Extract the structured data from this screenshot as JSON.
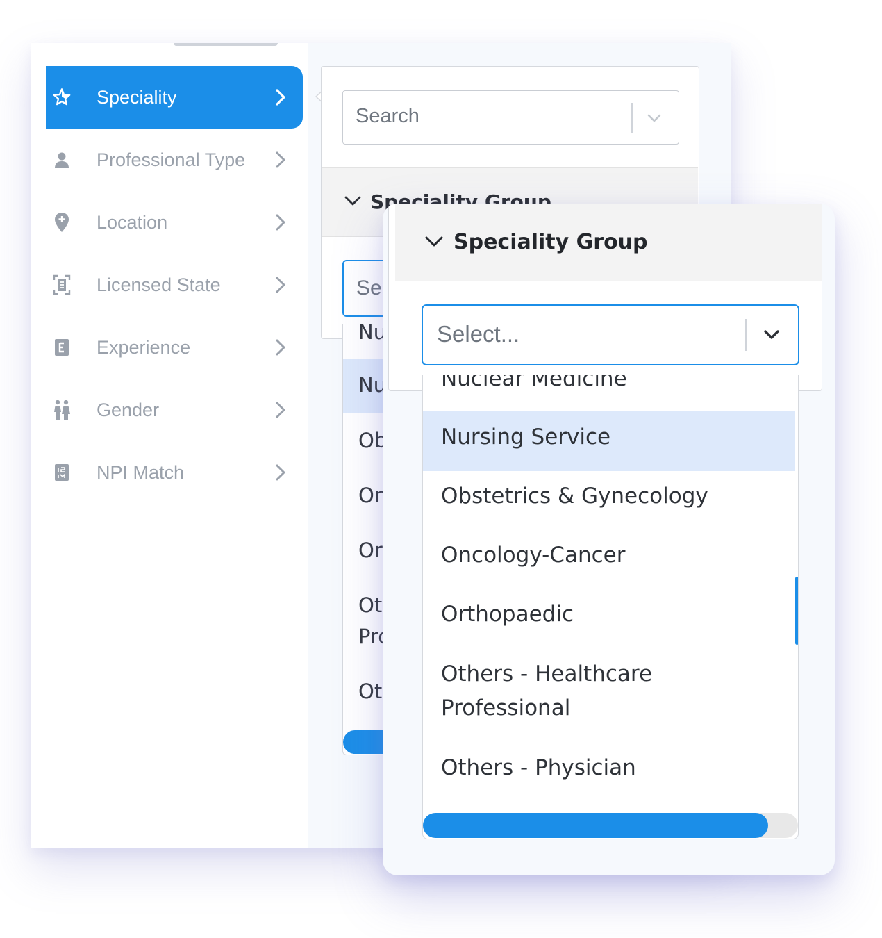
{
  "sidebar": {
    "items": [
      {
        "label": "Speciality",
        "icon": "star-icon",
        "active": true
      },
      {
        "label": "Professional Type",
        "icon": "person-icon",
        "active": false
      },
      {
        "label": "Location",
        "icon": "location-pin-icon",
        "active": false
      },
      {
        "label": "Licensed State",
        "icon": "id-card-icon",
        "active": false
      },
      {
        "label": "Experience",
        "icon": "experience-icon",
        "active": false
      },
      {
        "label": "Gender",
        "icon": "gender-icon",
        "active": false
      },
      {
        "label": "NPI Match",
        "icon": "npi-icon",
        "active": false
      }
    ]
  },
  "panel": {
    "search_placeholder": "Search",
    "group_title": "Speciality Group",
    "select_placeholder_partial": "Sel",
    "clipped_items": [
      "Nuc",
      "Nur",
      "Obs",
      "Onc",
      "Ort",
      "Oth",
      "Pro",
      "Oth"
    ]
  },
  "popup": {
    "group_title": "Speciality Group",
    "select_placeholder": "Select...",
    "options": [
      "Nuclear Medicine",
      "Nursing Service",
      "Obstetrics & Gynecology",
      "Oncology-Cancer",
      "Orthopaedic",
      "Others - Healthcare",
      "Professional",
      "Others - Physician"
    ],
    "highlighted_option": "Nursing Service"
  },
  "colors": {
    "accent": "#1b8ee8",
    "highlight": "#dde9fb",
    "muted_text": "#9aa1ab"
  }
}
